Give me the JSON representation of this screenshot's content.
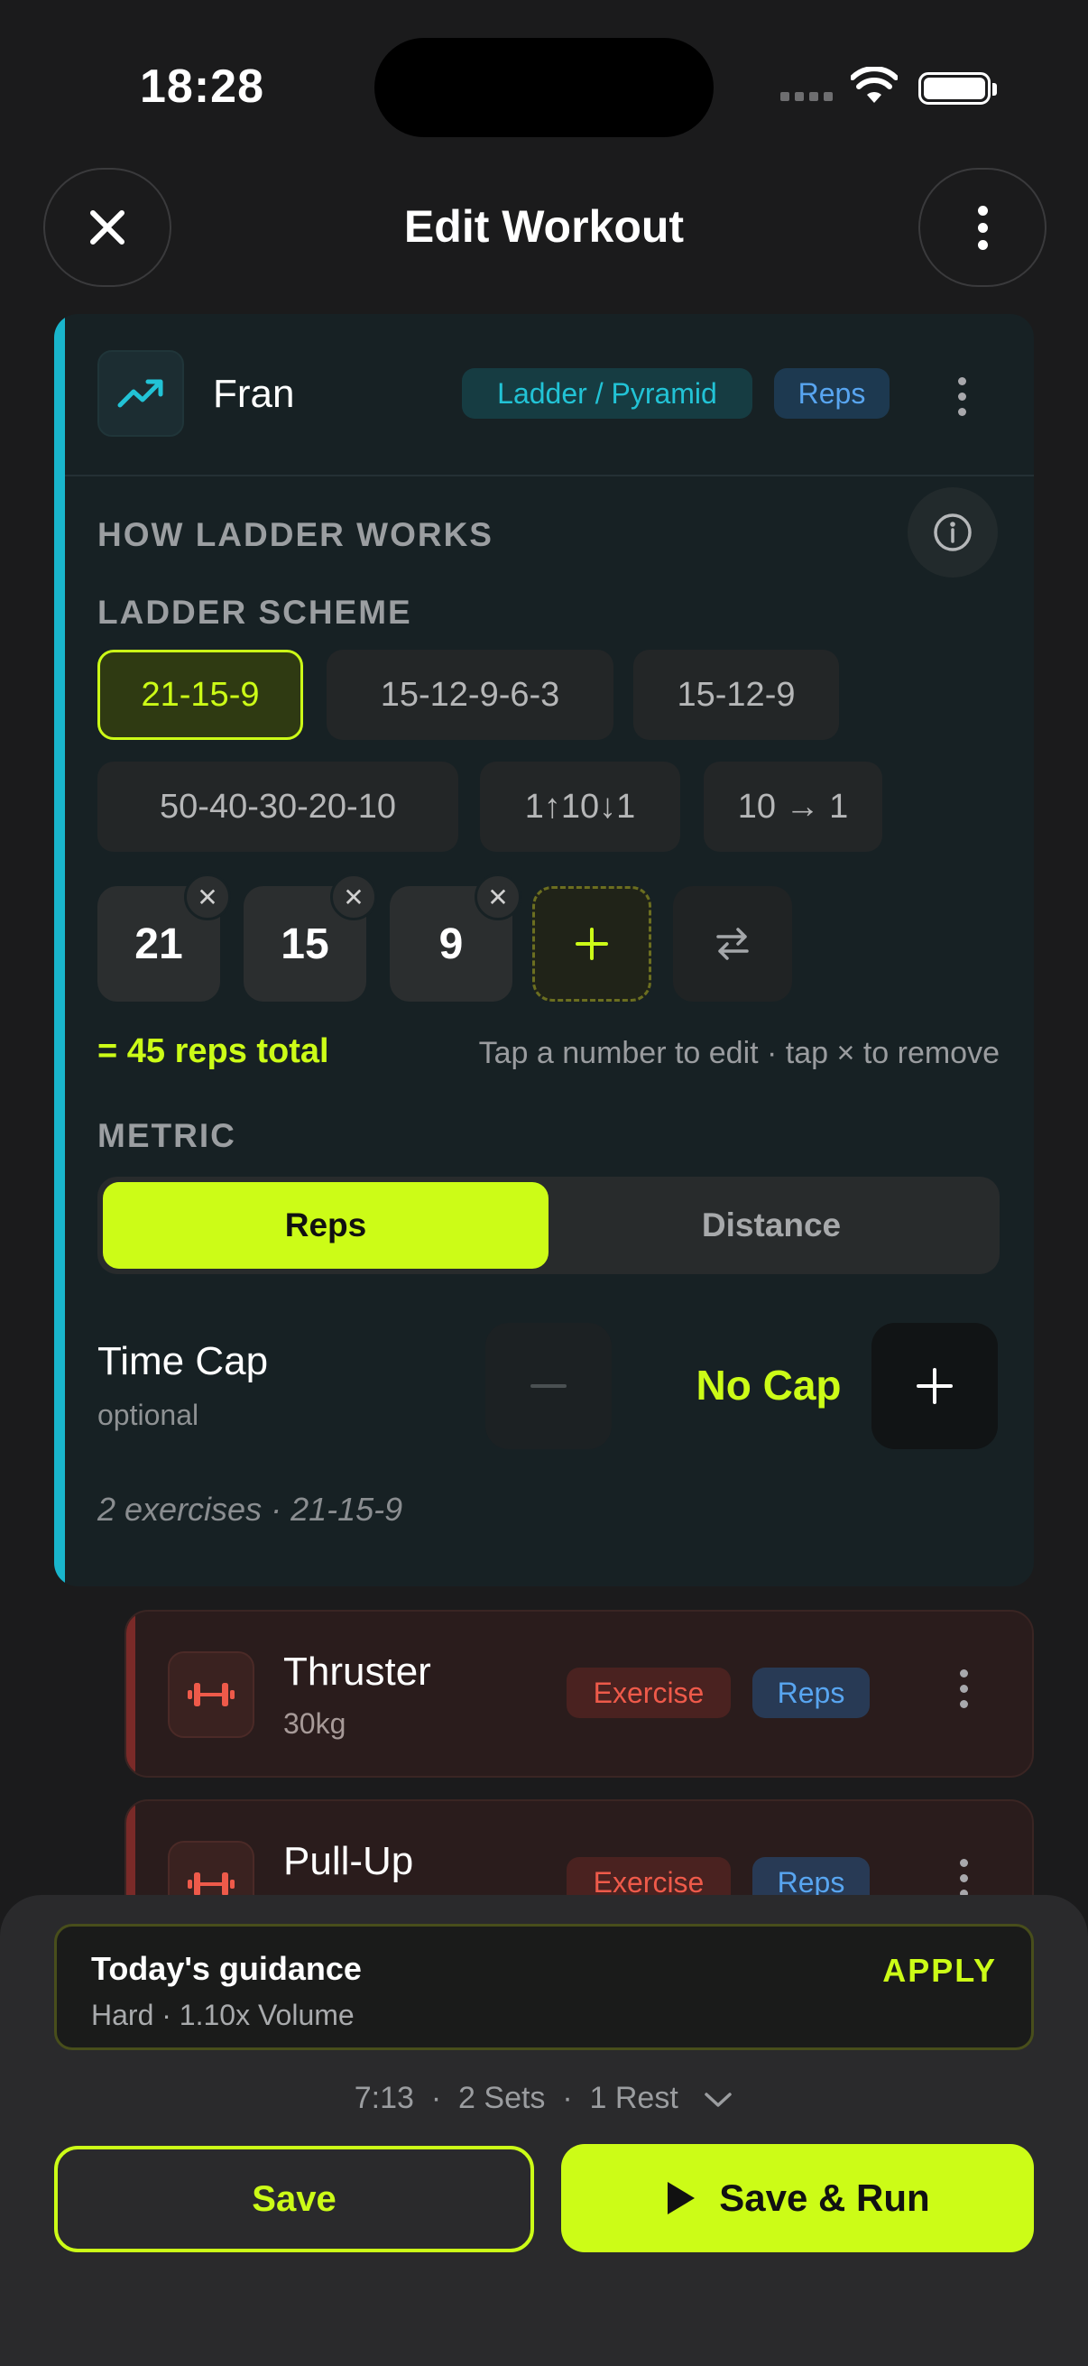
{
  "status_bar": {
    "time": "18:28"
  },
  "header": {
    "title": "Edit Workout"
  },
  "workout": {
    "name": "Fran",
    "type_badge": "Ladder / Pyramid",
    "metric_badge": "Reps",
    "how_label": "HOW LADDER WORKS",
    "scheme_label": "LADDER SCHEME",
    "presets": [
      "21-15-9",
      "15-12-9-6-3",
      "15-12-9",
      "50-40-30-20-10",
      "1↑10↓1",
      "10 → 1"
    ],
    "selected_preset": "21-15-9",
    "numbers": [
      "21",
      "15",
      "9"
    ],
    "total": "= 45 reps total",
    "hint": "Tap a number to edit · tap × to remove",
    "metric_label": "METRIC",
    "metric_options": [
      "Reps",
      "Distance"
    ],
    "metric_selected": "Reps",
    "time_cap_title": "Time Cap",
    "time_cap_sub": "optional",
    "time_cap_value": "No Cap",
    "summary": "2 exercises · 21-15-9"
  },
  "exercises": [
    {
      "name": "Thruster",
      "sub": "30kg",
      "badge": "Exercise",
      "metric": "Reps"
    },
    {
      "name": "Pull-Up",
      "sub": "",
      "badge": "Exercise",
      "metric": "Reps"
    }
  ],
  "guidance": {
    "title": "Today's guidance",
    "sub": "Hard · 1.10x Volume",
    "action": "APPLY"
  },
  "stats": {
    "text": "7:13  ·  2 Sets  ·  1 Rest"
  },
  "actions": {
    "save": "Save",
    "save_run": "Save & Run"
  },
  "colors": {
    "accent": "#ccfc17",
    "ladder": "#19b5cc",
    "exercise": "#ee5a4a",
    "reps": "#58a5f0"
  }
}
